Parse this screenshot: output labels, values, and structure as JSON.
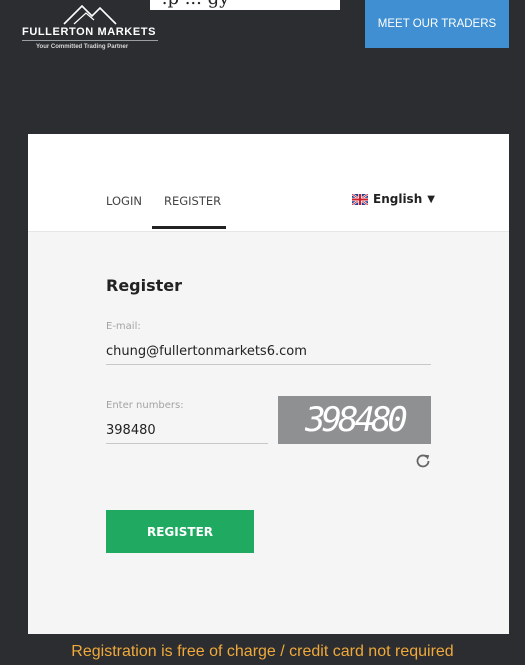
{
  "top_artifact": {
    "text": "‘.p ... gy"
  },
  "brand": {
    "name": "FULLERTON MARKETS",
    "tagline": "Your Committed Trading Partner"
  },
  "header": {
    "meet_button": "MEET OUR TRADERS"
  },
  "tabs": [
    {
      "label": "LOGIN",
      "active": false
    },
    {
      "label": "REGISTER",
      "active": true
    }
  ],
  "language": {
    "selected": "English",
    "icon": "uk-flag-icon"
  },
  "form": {
    "title": "Register",
    "email": {
      "label": "E-mail:",
      "value": "chung@fullertonmarkets6.com"
    },
    "numbers": {
      "label": "Enter numbers:",
      "value": "398480"
    },
    "captcha_text": "398480",
    "submit_label": "REGISTER"
  },
  "footer": {
    "note": "Registration is free of charge / credit card not required"
  },
  "colors": {
    "page_bg": "#2b2d30",
    "meet_button": "#3f8fd2",
    "register_button": "#1fa961",
    "footer_note": "#f0a93a"
  }
}
